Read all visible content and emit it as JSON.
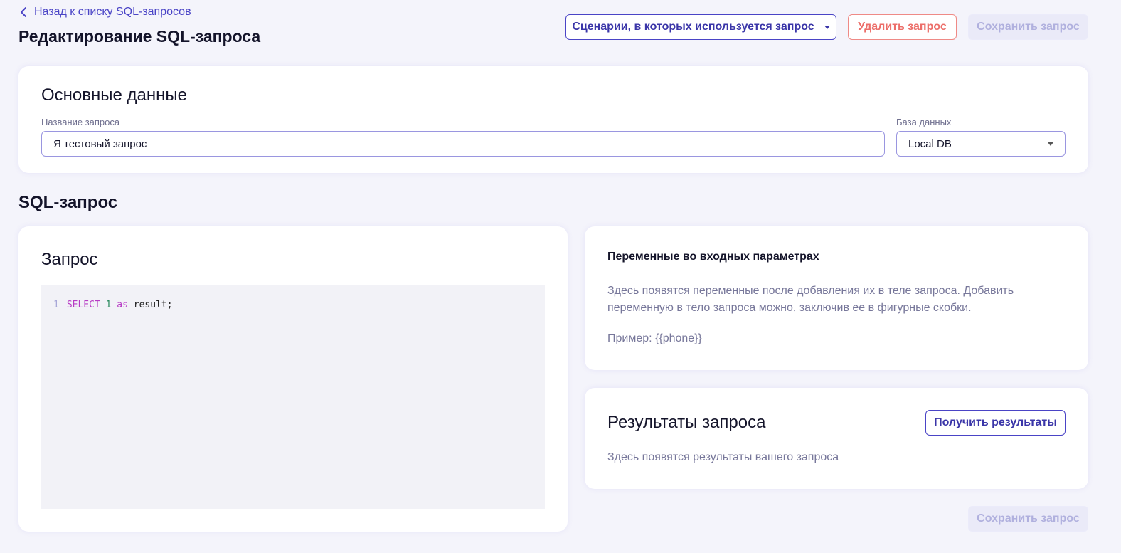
{
  "header": {
    "back_label": "Назад к списку SQL-запросов",
    "title": "Редактирование SQL-запроса",
    "scenarios_button": "Сценарии, в которых используется запрос",
    "delete_button": "Удалить запрос",
    "save_button": "Сохранить запрос"
  },
  "main": {
    "title": "Основные данные",
    "name_label": "Название запроса",
    "name_value": "Я тестовый запрос",
    "db_label": "База данных",
    "db_value": "Local DB"
  },
  "sql_section": {
    "title": "SQL-запрос"
  },
  "query": {
    "title": "Запрос",
    "line_number": "1",
    "tokens": {
      "select": "SELECT",
      "one": "1",
      "as": "as",
      "rest": "result;"
    }
  },
  "variables": {
    "title": "Переменные во входных параметрах",
    "description": "Здесь появятся переменные после добавления их в теле запроса. Добавить переменную в тело запроса можно, заключив ее в фигурные скобки.",
    "example": "Пример: {{phone}}"
  },
  "results": {
    "title": "Результаты запроса",
    "get_button": "Получить результаты",
    "empty_text": "Здесь появятся результаты вашего запроса"
  },
  "footer": {
    "save_button": "Сохранить запрос"
  },
  "icons": {
    "back": "chevron-left-icon",
    "dropdown": "caret-down-icon"
  },
  "colors": {
    "accent": "#4a44c6",
    "danger": "#ec6e69",
    "disabled": "#b0b0de",
    "background": "#f4f4fb"
  }
}
